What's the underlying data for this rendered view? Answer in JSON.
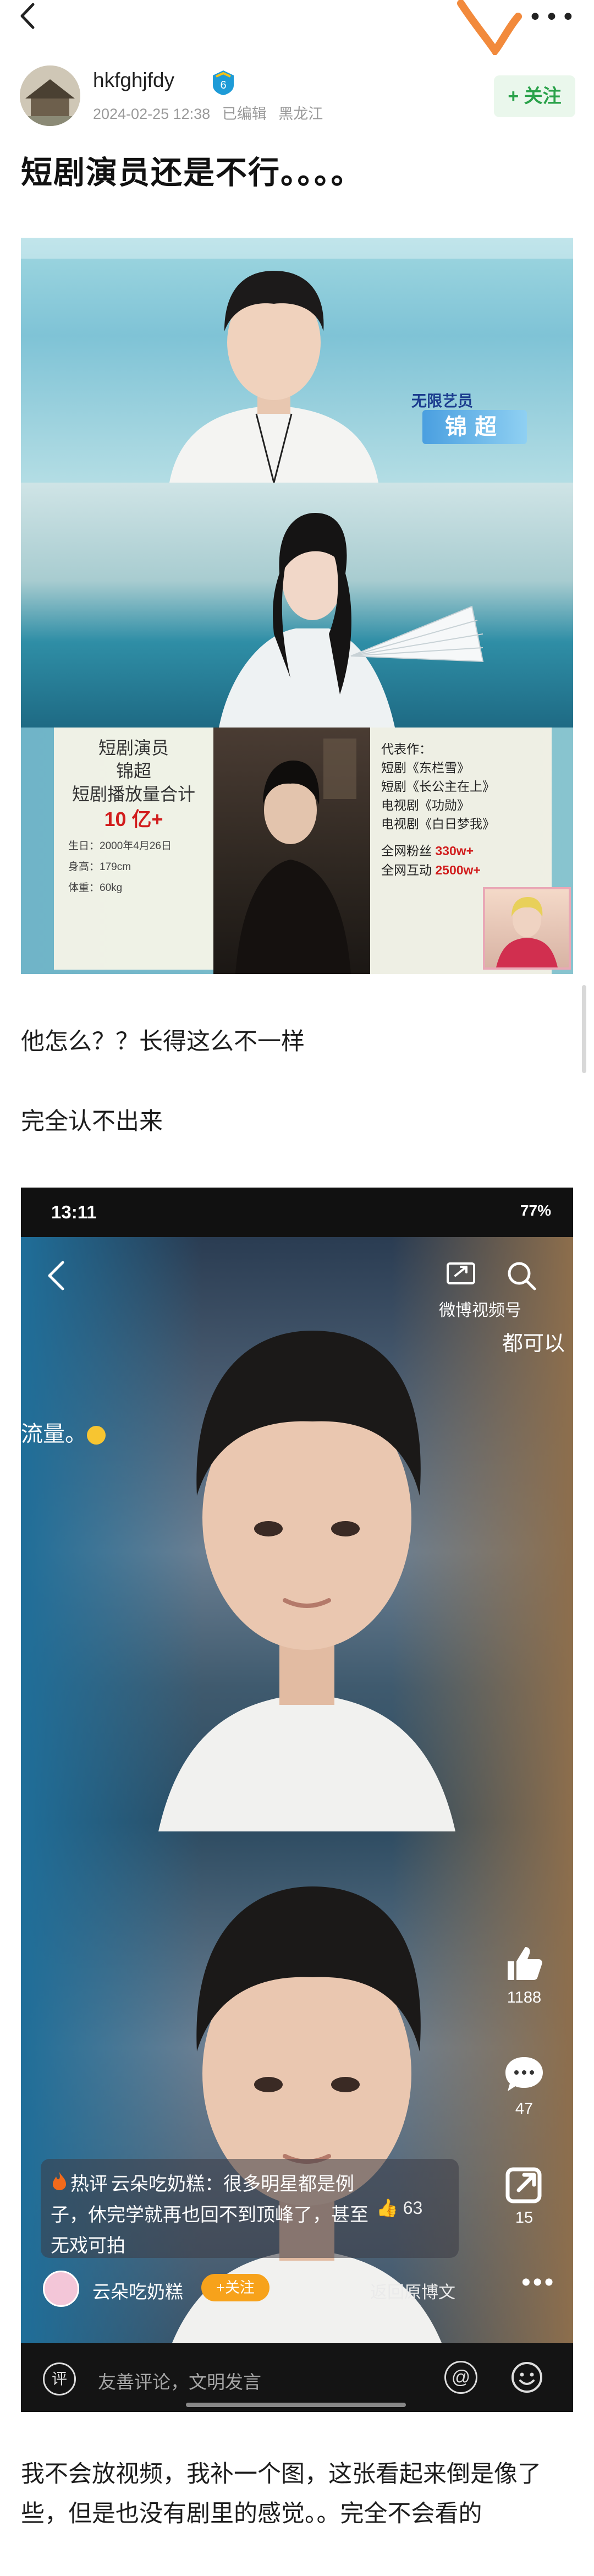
{
  "post": {
    "author_name": "hkfghjfdy",
    "badge_level": "6",
    "date": "2024-02-25 12:38",
    "edited": "已编辑",
    "location": "黑龙江",
    "follow_label": "+ 关注",
    "title": "短剧演员还是不行。。。。",
    "paragraph1": "他怎么？？长得这么不一样",
    "paragraph2": "完全认不出来",
    "bottom_text": "我不会放视频，我补一个图，这张看起来倒是像了些，但是也没有剧里的感觉。。完全不会看的"
  },
  "image1": {
    "top_caption": "无限艺员",
    "name_tag": "锦超",
    "card_left": {
      "line1": "短剧演员",
      "line2": "锦超",
      "line3": "短剧播放量合计",
      "total": "10 亿+",
      "birthday": "生日：2000年4月26日",
      "height": "身高：179cm",
      "weight": "体重：60kg"
    },
    "card_right": {
      "heading": "代表作：",
      "work1": "短剧《东栏雪》",
      "work2": "短剧《长公主在上》",
      "work3": "电视剧《功勋》",
      "work4": "电视剧《白日梦我》",
      "fans_label": "全网粉丝",
      "fans_value": "330w+",
      "interact_label": "全网互动",
      "interact_value": "2500w+"
    }
  },
  "image2": {
    "clock": "13:11",
    "indicators": "77%",
    "watermark": "微博视频号",
    "watermark_sub": "@云朵吃奶糕",
    "top_right_text": "都可以",
    "side_text": "流量。",
    "like_count": "1188",
    "comment_count": "47",
    "share_count": "15",
    "hot_label": "热评",
    "hot_text": "云朵吃奶糕：很多明星都是例子，休完学就再也回不到顶峰了，甚至无戏可拍",
    "hot_likes": "63",
    "uploader": "云朵吃奶糕",
    "uploader_follow": "+关注",
    "return_label": "返回原博文",
    "comment_avatar_glyph": "评",
    "comment_placeholder": "友善评论，文明发言",
    "at_glyph": "@"
  },
  "icons": {
    "back": "chevron-left-icon",
    "more": "more-icon",
    "like": "thumbs-up-icon",
    "comment": "chat-bubble-icon",
    "share": "share-icon"
  },
  "colors": {
    "follow_green": "#2aa24a",
    "follow_orange": "#f7a21b",
    "highlight_red": "#d11d1d"
  }
}
